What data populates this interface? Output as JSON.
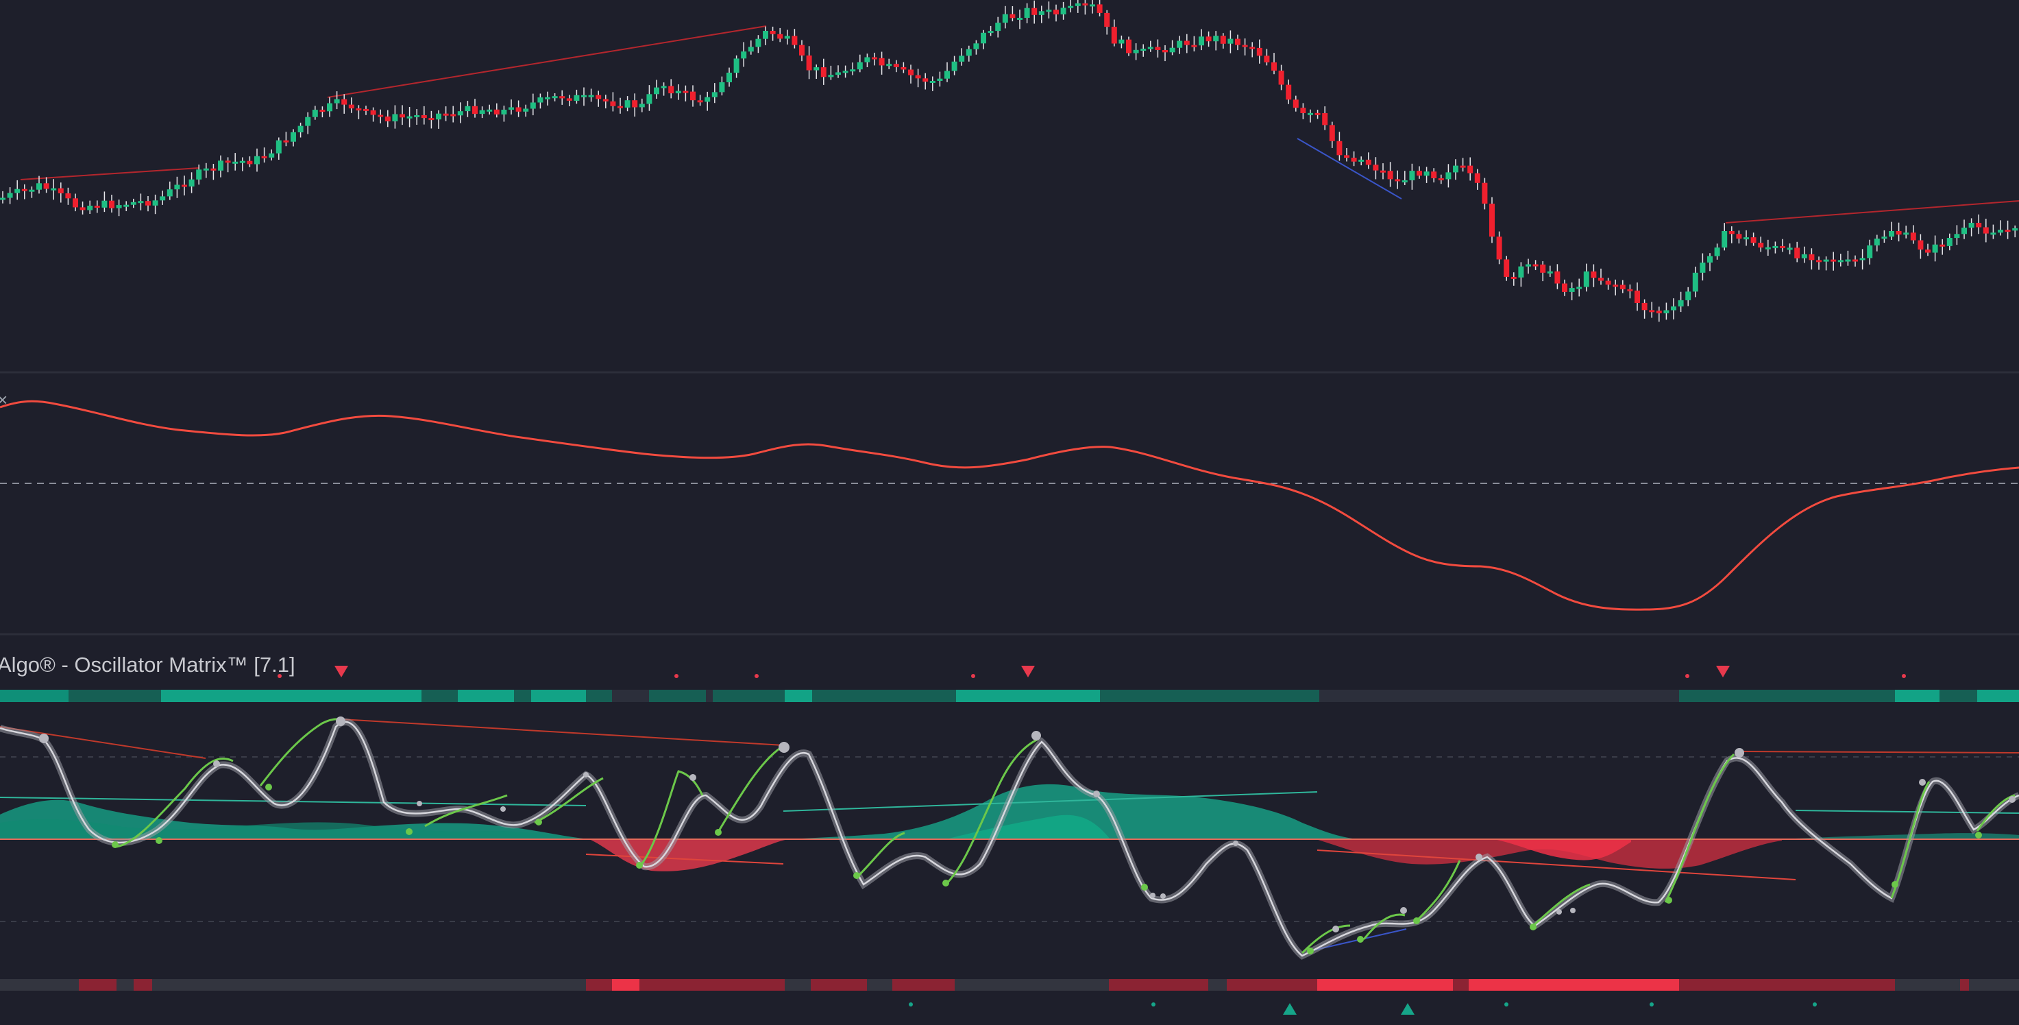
{
  "indicator": {
    "title": "Algo® - Oscillator Matrix™ [7.1]",
    "close_glyph": "×"
  },
  "colors": {
    "background": "#1e1f2b",
    "bull": "#1fbf83",
    "bear": "#f0202e",
    "oscillator_line": "#f24b3f",
    "teal_fill": "#16a589",
    "red_fill": "#e8394d",
    "wave_green": "#6cc84a",
    "wave_gray": "#c4c4cc",
    "divergence_red": "#c0392b",
    "divergence_blue": "#3a55c8",
    "separator": "#2c2e3a"
  },
  "icons": {
    "triangle_down": "triangle-down-icon",
    "triangle_up": "triangle-up-icon"
  }
}
